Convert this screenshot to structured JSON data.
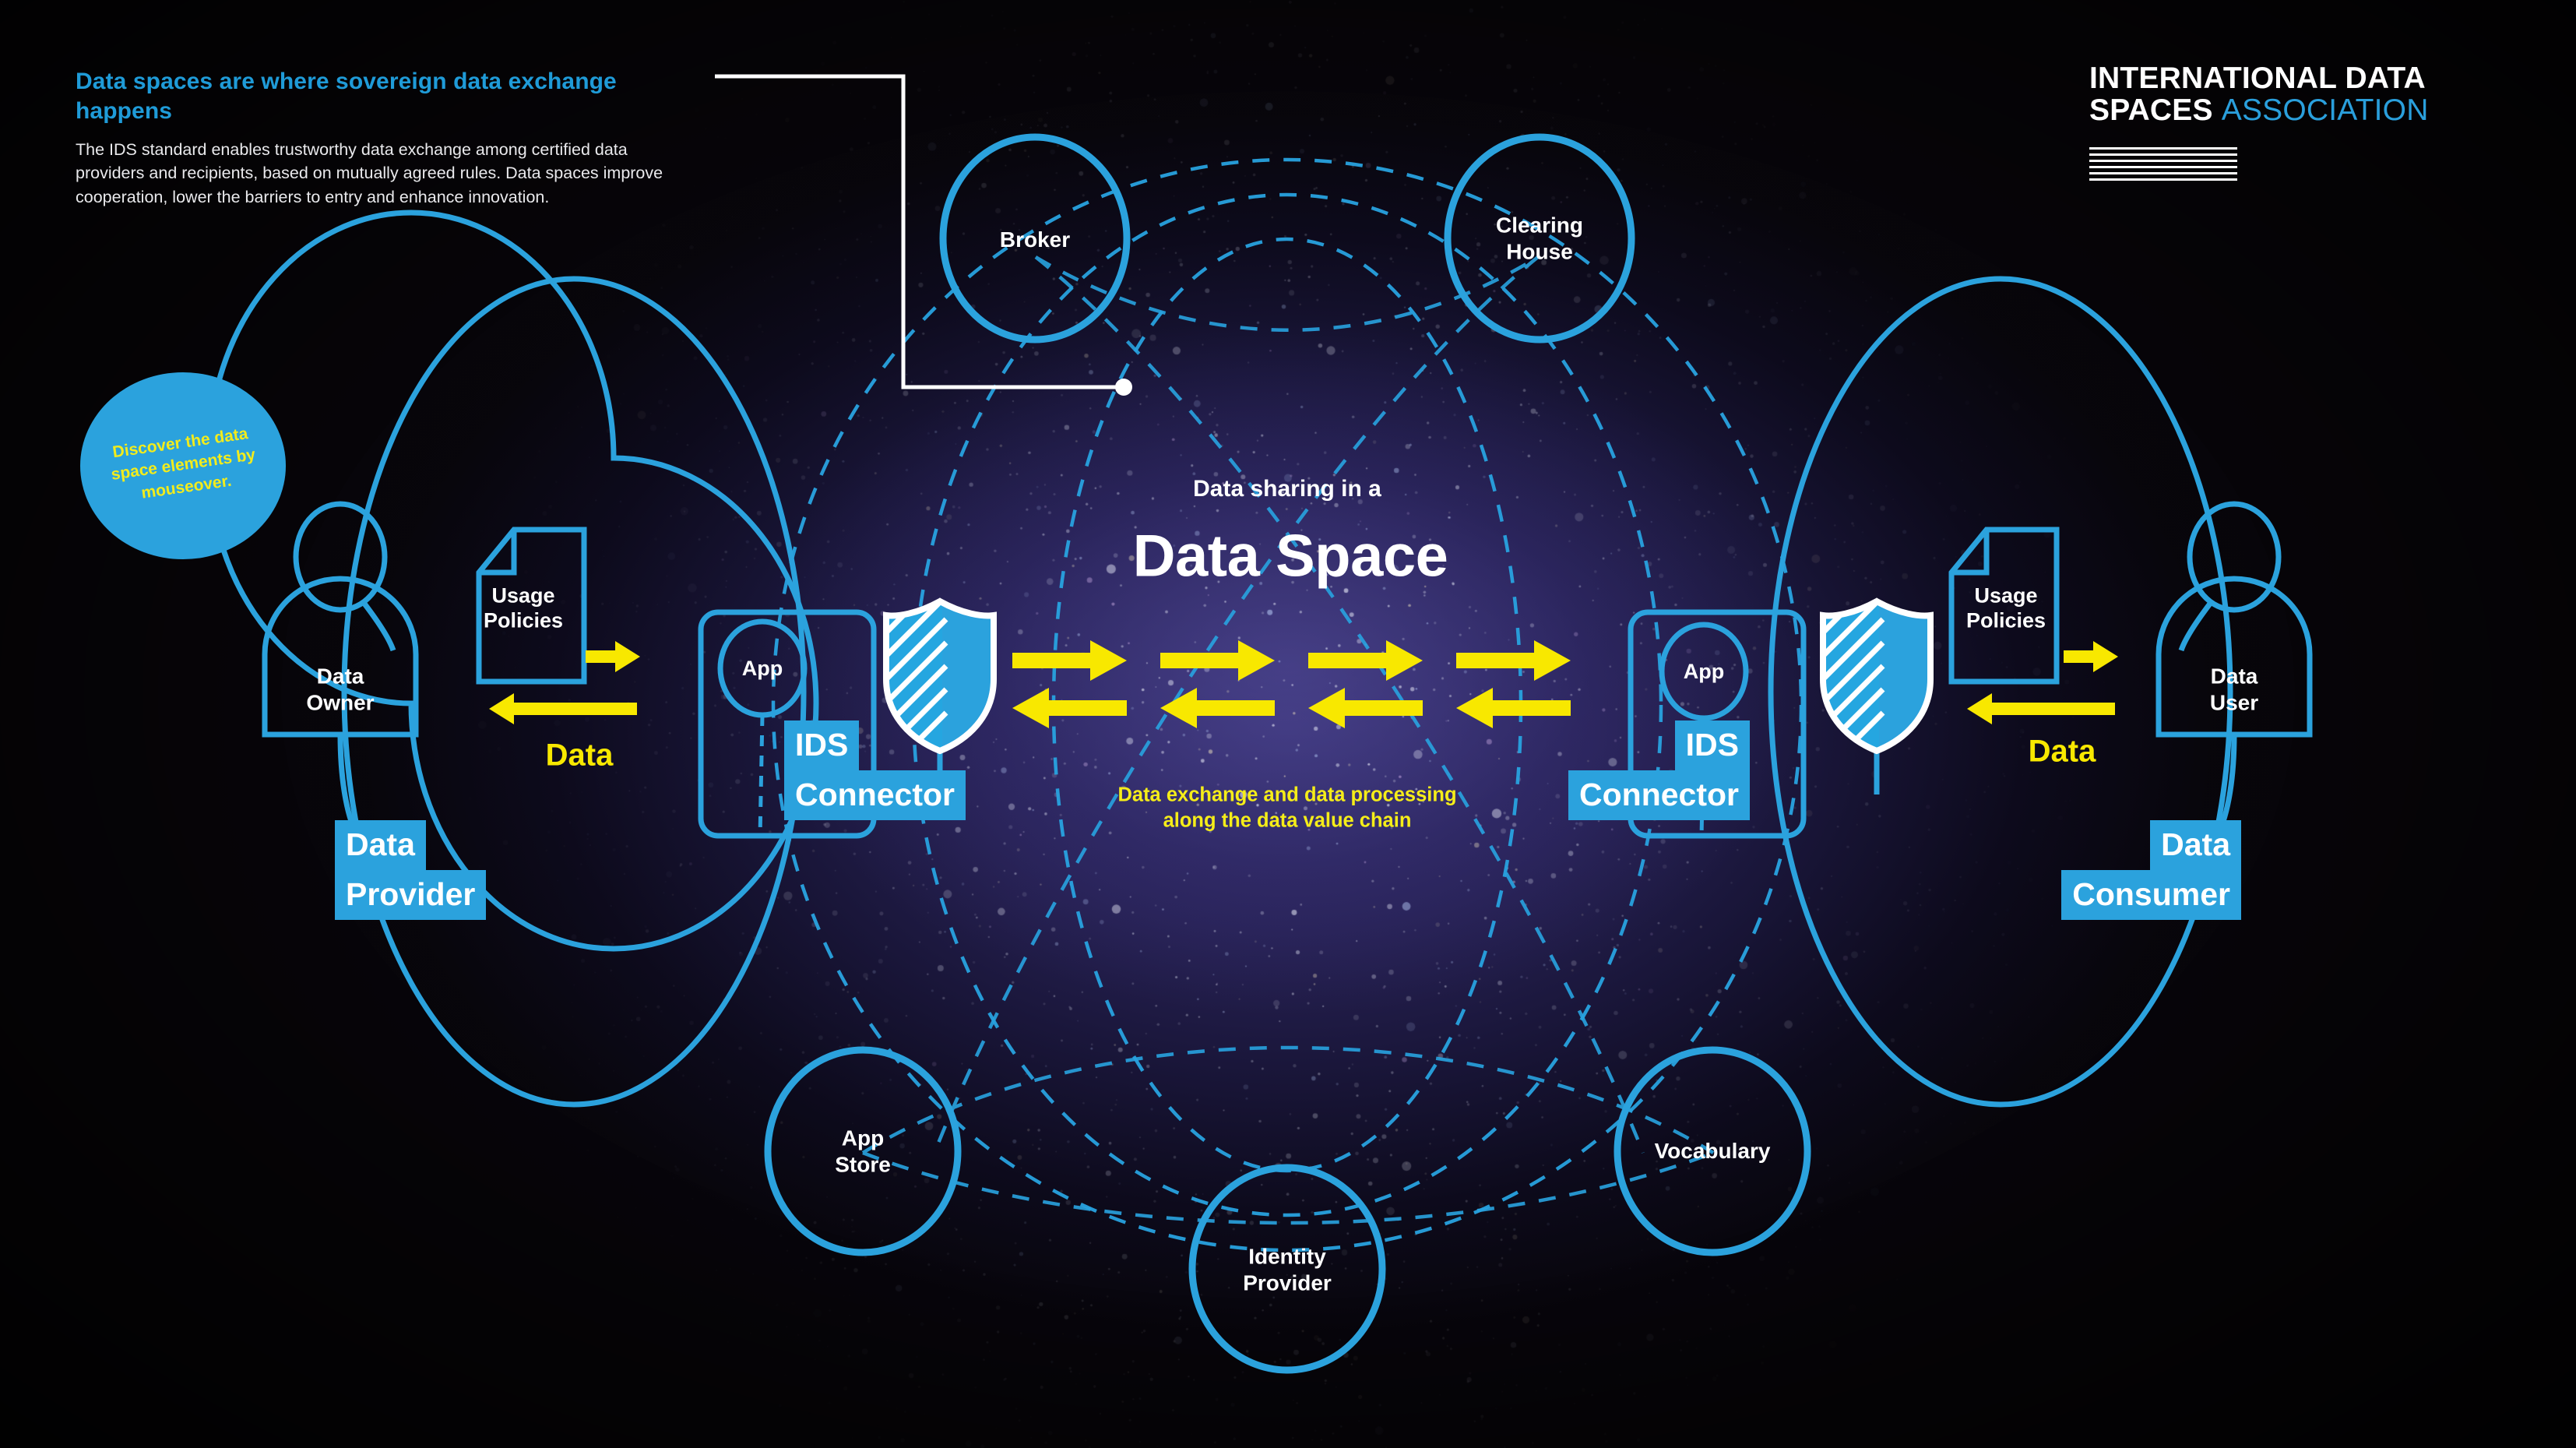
{
  "intro": {
    "heading": "Data spaces are where sovereign data exchange happens",
    "body": "The IDS standard enables trustworthy data exchange among certified data providers and recipients, based on mutually agreed rules. Data spaces improve cooperation, lower the barriers to entry and enhance innovation."
  },
  "logo": {
    "line1": "INTERNATIONAL DATA",
    "line2_white": "SPACES ",
    "line2_blue": "ASSOCIATION"
  },
  "discover": {
    "text": "Discover the data space elements by mouseover."
  },
  "center": {
    "subtitle": "Data sharing in a",
    "title": "Data Space",
    "caption": "Data exchange and data processing\nalong the data value chain"
  },
  "nodes": [
    {
      "id": "broker",
      "label": "Broker"
    },
    {
      "id": "clearing-house",
      "label": "Clearing\nHouse"
    },
    {
      "id": "app-store",
      "label": "App\nStore"
    },
    {
      "id": "identity-provider",
      "label": "Identity\nProvider"
    },
    {
      "id": "vocabulary",
      "label": "Vocabulary"
    }
  ],
  "provider": {
    "person_label": "Data\nOwner",
    "doc_label": "Usage\nPolicies",
    "app_label": "App",
    "data_label": "Data",
    "connector_line1": "IDS",
    "connector_line2": "Connector",
    "role_line1": "Data",
    "role_line2": "Provider"
  },
  "consumer": {
    "person_label": "Data\nUser",
    "doc_label": "Usage\nPolicies",
    "app_label": "App",
    "data_label": "Data",
    "connector_line1": "IDS",
    "connector_line2": "Connector",
    "role_line1": "Data",
    "role_line2": "Consumer"
  },
  "colors": {
    "accent_blue": "#2ba2dd",
    "yellow": "#f8e800",
    "white": "#ffffff",
    "background": "#070508",
    "nebula": "#3a3478"
  }
}
